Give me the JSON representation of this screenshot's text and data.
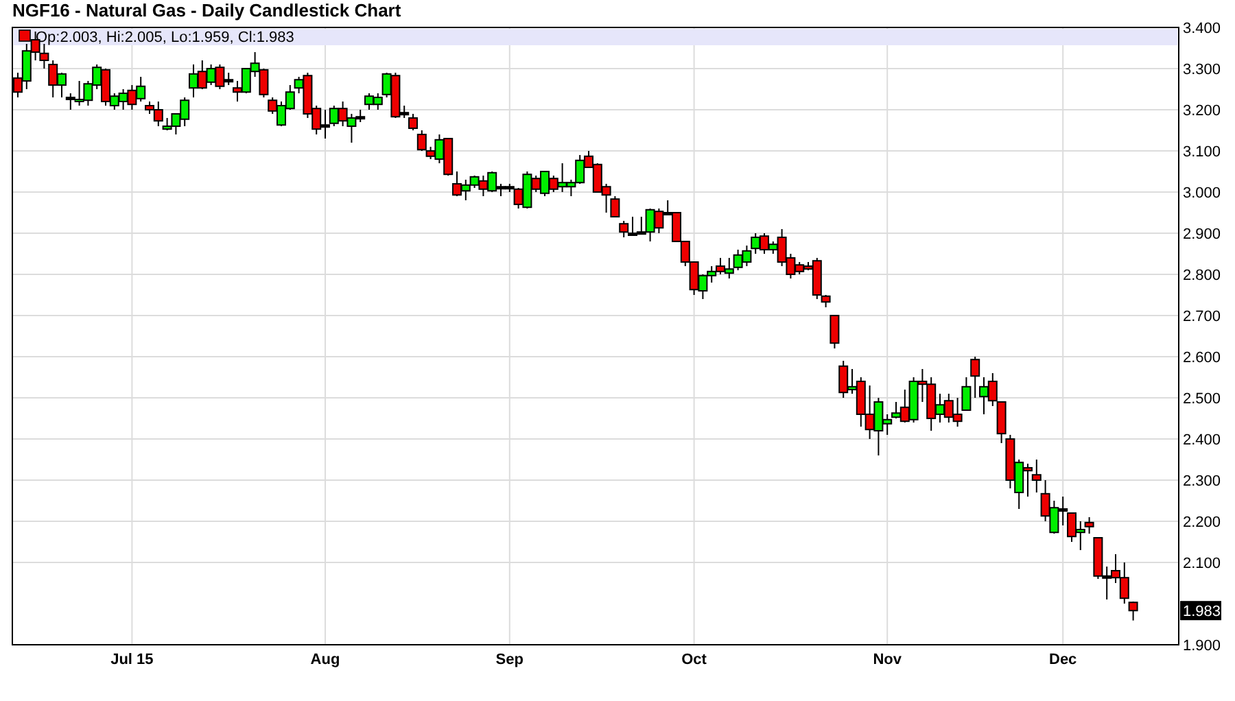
{
  "title": "NGF16 - Natural Gas - Daily Candlestick Chart",
  "legend": {
    "text": "Op:2.003, Hi:2.005, Lo:1.959, Cl:1.983"
  },
  "last_price_tag": "1.983",
  "chart_data": {
    "type": "candlestick",
    "categories": [
      null,
      null,
      null,
      null,
      null,
      null,
      null,
      null,
      null,
      null,
      null,
      null,
      null,
      "Jul 15",
      null,
      null,
      null,
      null,
      null,
      null,
      null,
      null,
      null,
      null,
      null,
      null,
      null,
      null,
      null,
      null,
      null,
      null,
      null,
      null,
      null,
      "Aug",
      null,
      null,
      null,
      null,
      null,
      null,
      null,
      null,
      null,
      null,
      null,
      null,
      null,
      null,
      null,
      null,
      null,
      null,
      null,
      null,
      "Sep",
      null,
      null,
      null,
      null,
      null,
      null,
      null,
      null,
      null,
      null,
      null,
      null,
      null,
      null,
      null,
      null,
      null,
      null,
      null,
      null,
      "Oct",
      null,
      null,
      null,
      null,
      null,
      null,
      null,
      null,
      null,
      null,
      null,
      null,
      null,
      null,
      null,
      null,
      null,
      null,
      null,
      null,
      null,
      "Nov",
      null,
      null,
      null,
      null,
      null,
      null,
      null,
      null,
      null,
      null,
      null,
      null,
      null,
      null,
      null,
      null,
      null,
      null,
      null,
      "Dec",
      null,
      null,
      null,
      null,
      null,
      null,
      null,
      null
    ],
    "ylim": [
      1.9,
      3.4
    ],
    "grid": true,
    "yticks": [
      {
        "value": 3.4,
        "label": "3.400"
      },
      {
        "value": 3.3,
        "label": "3.300"
      },
      {
        "value": 3.2,
        "label": "3.200"
      },
      {
        "value": 3.1,
        "label": "3.100"
      },
      {
        "value": 3.0,
        "label": "3.000"
      },
      {
        "value": 2.9,
        "label": "2.900"
      },
      {
        "value": 2.8,
        "label": "2.800"
      },
      {
        "value": 2.7,
        "label": "2.700"
      },
      {
        "value": 2.6,
        "label": "2.600"
      },
      {
        "value": 2.5,
        "label": "2.500"
      },
      {
        "value": 2.4,
        "label": "2.400"
      },
      {
        "value": 2.3,
        "label": "2.300"
      },
      {
        "value": 2.2,
        "label": "2.200"
      },
      {
        "value": 2.1,
        "label": "2.100"
      },
      {
        "value": 1.9,
        "label": "1.900"
      }
    ],
    "ohlc": [
      [
        3.277,
        3.29,
        3.23,
        3.243
      ],
      [
        3.27,
        3.36,
        3.25,
        3.343
      ],
      [
        3.37,
        3.39,
        3.32,
        3.34
      ],
      [
        3.337,
        3.36,
        3.3,
        3.32
      ],
      [
        3.31,
        3.32,
        3.23,
        3.26
      ],
      [
        3.26,
        3.29,
        3.23,
        3.287
      ],
      [
        3.23,
        3.24,
        3.2,
        3.23
      ],
      [
        3.222,
        3.27,
        3.21,
        3.225
      ],
      [
        3.223,
        3.27,
        3.21,
        3.263
      ],
      [
        3.26,
        3.31,
        3.25,
        3.303
      ],
      [
        3.297,
        3.3,
        3.21,
        3.22
      ],
      [
        3.21,
        3.24,
        3.2,
        3.233
      ],
      [
        3.22,
        3.25,
        3.2,
        3.24
      ],
      [
        3.247,
        3.26,
        3.2,
        3.213
      ],
      [
        3.227,
        3.28,
        3.22,
        3.257
      ],
      [
        3.21,
        3.22,
        3.19,
        3.2
      ],
      [
        3.2,
        3.22,
        3.16,
        3.173
      ],
      [
        3.153,
        3.18,
        3.15,
        3.16
      ],
      [
        3.16,
        3.19,
        3.14,
        3.19
      ],
      [
        3.177,
        3.23,
        3.16,
        3.223
      ],
      [
        3.253,
        3.31,
        3.23,
        3.287
      ],
      [
        3.293,
        3.32,
        3.25,
        3.253
      ],
      [
        3.267,
        3.31,
        3.26,
        3.3
      ],
      [
        3.303,
        3.31,
        3.25,
        3.257
      ],
      [
        3.273,
        3.29,
        3.26,
        3.273
      ],
      [
        3.253,
        3.27,
        3.22,
        3.243
      ],
      [
        3.243,
        3.3,
        3.24,
        3.3
      ],
      [
        3.293,
        3.34,
        3.28,
        3.313
      ],
      [
        3.297,
        3.3,
        3.23,
        3.237
      ],
      [
        3.223,
        3.23,
        3.19,
        3.197
      ],
      [
        3.163,
        3.22,
        3.16,
        3.21
      ],
      [
        3.203,
        3.26,
        3.2,
        3.243
      ],
      [
        3.253,
        3.28,
        3.24,
        3.273
      ],
      [
        3.283,
        3.29,
        3.18,
        3.19
      ],
      [
        3.203,
        3.21,
        3.14,
        3.153
      ],
      [
        3.163,
        3.2,
        3.13,
        3.163
      ],
      [
        3.167,
        3.21,
        3.16,
        3.203
      ],
      [
        3.203,
        3.22,
        3.16,
        3.173
      ],
      [
        3.16,
        3.19,
        3.12,
        3.18
      ],
      [
        3.183,
        3.2,
        3.17,
        3.183
      ],
      [
        3.213,
        3.24,
        3.2,
        3.233
      ],
      [
        3.213,
        3.24,
        3.2,
        3.23
      ],
      [
        3.237,
        3.29,
        3.23,
        3.287
      ],
      [
        3.283,
        3.29,
        3.18,
        3.183
      ],
      [
        3.193,
        3.21,
        3.18,
        3.193
      ],
      [
        3.18,
        3.19,
        3.15,
        3.155
      ],
      [
        3.14,
        3.15,
        3.1,
        3.103
      ],
      [
        3.1,
        3.11,
        3.08,
        3.087
      ],
      [
        3.08,
        3.14,
        3.07,
        3.127
      ],
      [
        3.13,
        3.13,
        3.04,
        3.043
      ],
      [
        3.02,
        3.05,
        2.99,
        2.993
      ],
      [
        3.003,
        3.03,
        2.98,
        3.017
      ],
      [
        3.017,
        3.04,
        3.01,
        3.037
      ],
      [
        3.027,
        3.04,
        2.99,
        3.007
      ],
      [
        3.003,
        3.05,
        3.0,
        3.047
      ],
      [
        3.013,
        3.02,
        2.99,
        3.013
      ],
      [
        3.013,
        3.02,
        3.0,
        3.013
      ],
      [
        3.007,
        3.01,
        2.96,
        2.97
      ],
      [
        2.963,
        3.05,
        2.96,
        3.043
      ],
      [
        3.033,
        3.04,
        3.0,
        3.007
      ],
      [
        2.997,
        3.05,
        2.99,
        3.05
      ],
      [
        3.033,
        3.04,
        3.0,
        3.007
      ],
      [
        3.013,
        3.07,
        3.0,
        3.023
      ],
      [
        3.013,
        3.03,
        2.99,
        3.023
      ],
      [
        3.023,
        3.09,
        3.02,
        3.077
      ],
      [
        3.087,
        3.1,
        3.06,
        3.06
      ],
      [
        3.067,
        3.07,
        3.0,
        3.0
      ],
      [
        3.013,
        3.02,
        2.95,
        2.993
      ],
      [
        2.983,
        2.99,
        2.94,
        2.94
      ],
      [
        2.923,
        2.93,
        2.89,
        2.903
      ],
      [
        2.9,
        2.94,
        2.9,
        2.9
      ],
      [
        2.903,
        2.94,
        2.9,
        2.903
      ],
      [
        2.903,
        2.96,
        2.88,
        2.957
      ],
      [
        2.953,
        2.96,
        2.9,
        2.913
      ],
      [
        2.95,
        2.98,
        2.95,
        2.95
      ],
      [
        2.95,
        2.95,
        2.88,
        2.88
      ],
      [
        2.88,
        2.88,
        2.82,
        2.83
      ],
      [
        2.83,
        2.83,
        2.75,
        2.763
      ],
      [
        2.76,
        2.8,
        2.74,
        2.797
      ],
      [
        2.797,
        2.82,
        2.78,
        2.807
      ],
      [
        2.82,
        2.84,
        2.8,
        2.807
      ],
      [
        2.803,
        2.84,
        2.79,
        2.813
      ],
      [
        2.817,
        2.86,
        2.81,
        2.847
      ],
      [
        2.83,
        2.87,
        2.82,
        2.857
      ],
      [
        2.863,
        2.9,
        2.85,
        2.89
      ],
      [
        2.893,
        2.9,
        2.85,
        2.86
      ],
      [
        2.86,
        2.88,
        2.85,
        2.873
      ],
      [
        2.89,
        2.91,
        2.82,
        2.83
      ],
      [
        2.84,
        2.85,
        2.79,
        2.8
      ],
      [
        2.823,
        2.83,
        2.8,
        2.807
      ],
      [
        2.82,
        2.83,
        2.81,
        2.813
      ],
      [
        2.833,
        2.84,
        2.74,
        2.75
      ],
      [
        2.747,
        2.75,
        2.72,
        2.733
      ],
      [
        2.7,
        2.7,
        2.62,
        2.633
      ],
      [
        2.577,
        2.59,
        2.5,
        2.513
      ],
      [
        2.52,
        2.57,
        2.51,
        2.527
      ],
      [
        2.54,
        2.55,
        2.43,
        2.46
      ],
      [
        2.46,
        2.53,
        2.4,
        2.423
      ],
      [
        2.42,
        2.5,
        2.36,
        2.49
      ],
      [
        2.437,
        2.46,
        2.41,
        2.447
      ],
      [
        2.453,
        2.49,
        2.45,
        2.463
      ],
      [
        2.477,
        2.52,
        2.44,
        2.443
      ],
      [
        2.447,
        2.55,
        2.44,
        2.54
      ],
      [
        2.54,
        2.57,
        2.49,
        2.533
      ],
      [
        2.533,
        2.55,
        2.42,
        2.45
      ],
      [
        2.46,
        2.51,
        2.44,
        2.483
      ],
      [
        2.493,
        2.51,
        2.44,
        2.453
      ],
      [
        2.46,
        2.5,
        2.43,
        2.443
      ],
      [
        2.47,
        2.55,
        2.47,
        2.527
      ],
      [
        2.593,
        2.6,
        2.5,
        2.553
      ],
      [
        2.503,
        2.55,
        2.46,
        2.527
      ],
      [
        2.54,
        2.56,
        2.48,
        2.493
      ],
      [
        2.49,
        2.49,
        2.39,
        2.413
      ],
      [
        2.4,
        2.41,
        2.28,
        2.3
      ],
      [
        2.27,
        2.35,
        2.23,
        2.343
      ],
      [
        2.33,
        2.34,
        2.26,
        2.323
      ],
      [
        2.313,
        2.35,
        2.27,
        2.3
      ],
      [
        2.267,
        2.3,
        2.2,
        2.213
      ],
      [
        2.173,
        2.25,
        2.17,
        2.233
      ],
      [
        2.23,
        2.26,
        2.19,
        2.23
      ],
      [
        2.22,
        2.22,
        2.15,
        2.163
      ],
      [
        2.173,
        2.2,
        2.13,
        2.18
      ],
      [
        2.197,
        2.21,
        2.17,
        2.187
      ],
      [
        2.16,
        2.16,
        2.06,
        2.067
      ],
      [
        2.067,
        2.09,
        2.01,
        2.067
      ],
      [
        2.08,
        2.12,
        2.05,
        2.063
      ],
      [
        2.063,
        2.1,
        2.0,
        2.013
      ],
      [
        2.003,
        2.005,
        1.959,
        1.983
      ]
    ]
  }
}
